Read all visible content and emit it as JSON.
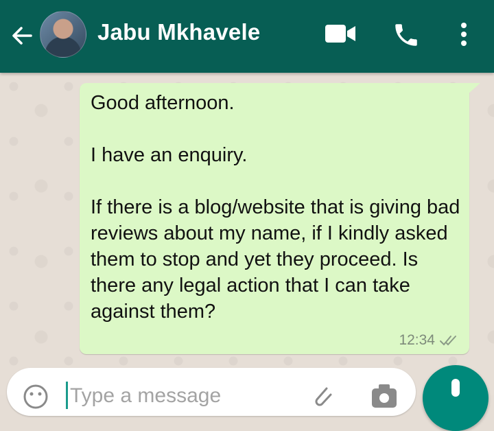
{
  "header": {
    "contact_name": "Jabu Mkhavele",
    "back_icon": "arrow-left-icon",
    "video_icon": "video-camera-icon",
    "call_icon": "phone-icon",
    "menu_icon": "more-vertical-icon",
    "bg_color": "#075e54"
  },
  "message": {
    "lines": [
      "Good afternoon.",
      "I have an enquiry.",
      "If there is a blog/website that is giving bad reviews about my name, if I kindly asked them to stop and yet they proceed. Is there any legal action that I can take against them?"
    ],
    "time": "12:34",
    "status_icon": "double-check-icon",
    "bubble_color": "#dcf8c6"
  },
  "composer": {
    "placeholder": "Type a message",
    "emoji_icon": "emoji-icon",
    "attach_icon": "paperclip-icon",
    "camera_icon": "camera-icon",
    "mic_icon": "microphone-icon",
    "accent": "#00897b"
  }
}
